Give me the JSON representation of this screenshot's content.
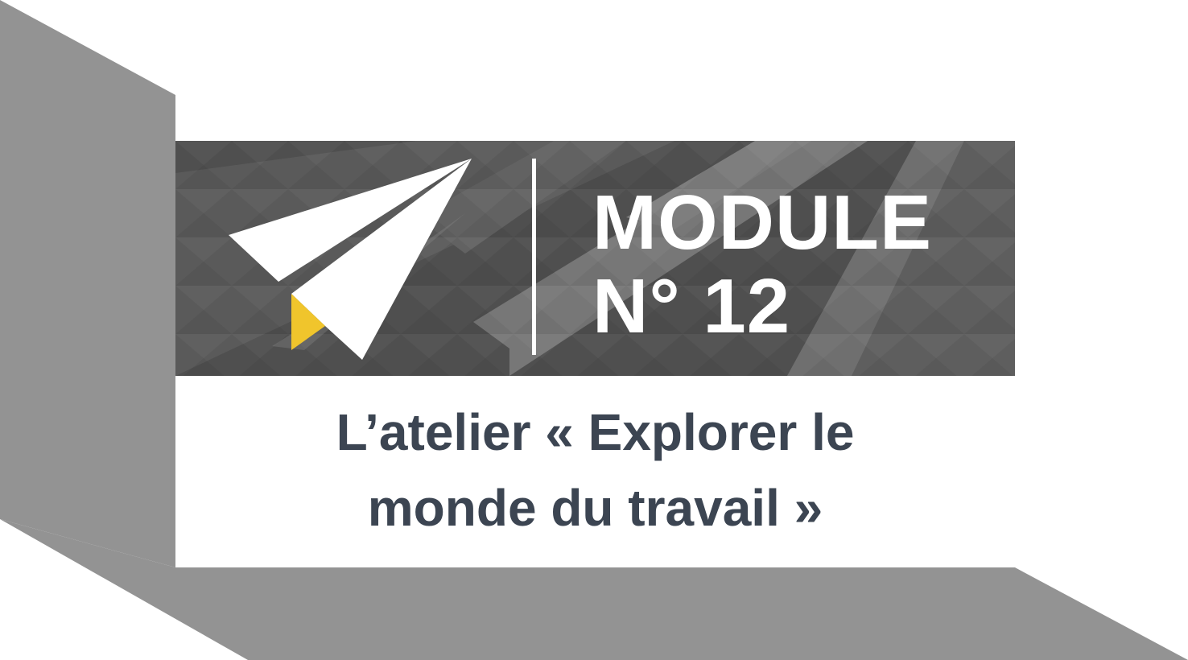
{
  "colors": {
    "frame_gray": "#939393",
    "banner_dark": "#4e4e4e",
    "banner_mid": "#6c6c6c",
    "banner_light": "#8a8a8a",
    "accent_yellow": "#f0c52c",
    "text_dark": "#3c4552",
    "white": "#ffffff"
  },
  "icons": {
    "logo": "paper-plane-icon"
  },
  "module": {
    "line1": "MODULE",
    "line2": "N° 12"
  },
  "subtitle": {
    "line1": "L’atelier « Explorer le",
    "line2": "monde du travail »"
  }
}
